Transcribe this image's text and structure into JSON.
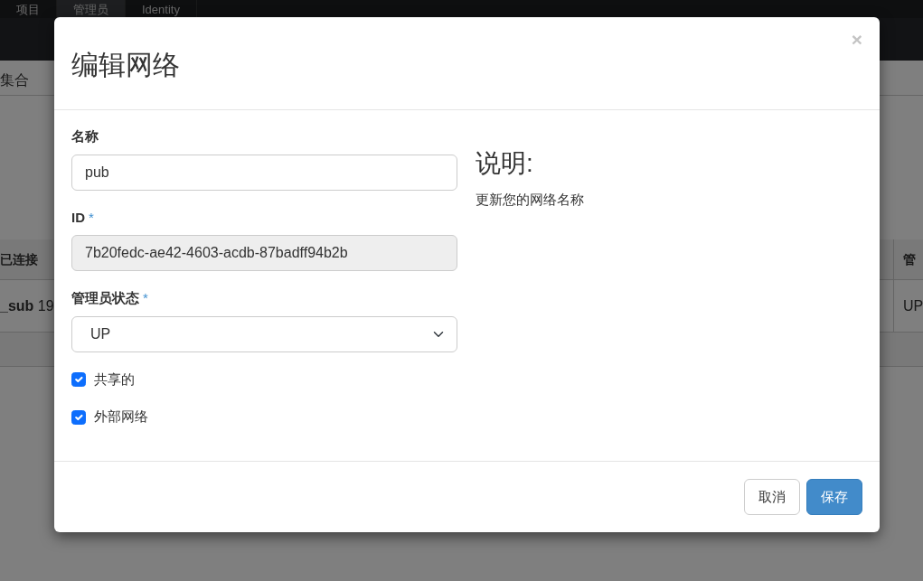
{
  "background": {
    "tabs": [
      {
        "label": "项目",
        "selected": false
      },
      {
        "label": "管理员",
        "selected": true
      },
      {
        "label": "Identity",
        "selected": false
      }
    ],
    "breadcrumb": "集合",
    "table": {
      "columns": [
        "已连接",
        "管"
      ],
      "rows": [
        [
          "**_sub** 19",
          "UP"
        ]
      ]
    }
  },
  "modal": {
    "title": "编辑网络",
    "close": "×",
    "fields": [
      {
        "kind": "text",
        "label": "名称",
        "value": "pub",
        "disabled": false
      },
      {
        "kind": "text",
        "label": "ID",
        "required_mark": "*",
        "value": "7b20fedc-ae42-4603-acdb-87badff94b2b",
        "disabled": true
      },
      {
        "kind": "select",
        "label": "管理员状态",
        "required_mark": "*",
        "value": "UP",
        "disabled": false
      }
    ],
    "checkboxes": [
      {
        "label": "共享的",
        "checked": true
      },
      {
        "label": "外部网络",
        "checked": true
      }
    ],
    "help": {
      "title": "说明:",
      "text": "更新您的网络名称"
    },
    "buttons": [
      {
        "kind": "secondary",
        "label": "取消"
      },
      {
        "kind": "primary",
        "label": "保存"
      }
    ]
  }
}
